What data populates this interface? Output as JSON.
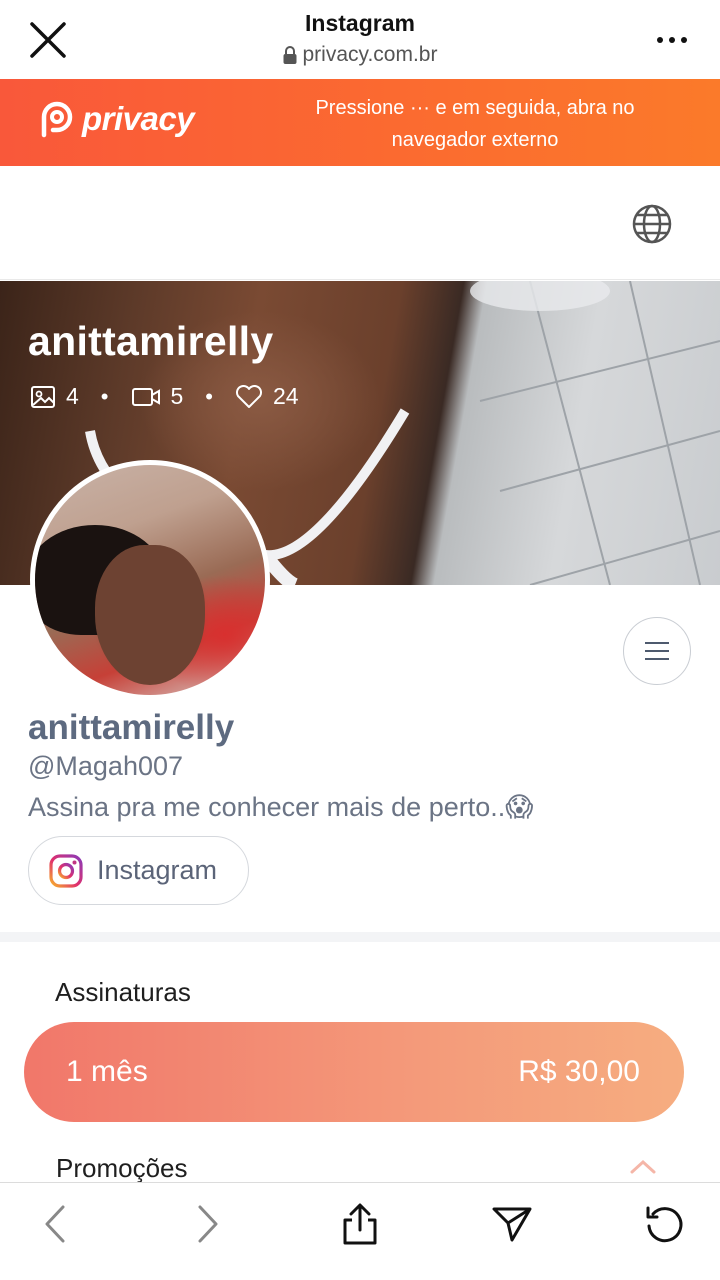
{
  "browser": {
    "title": "Instagram",
    "url": "privacy.com.br"
  },
  "banner": {
    "brand": "privacy",
    "message": "Pressione ··· e em seguida, abra no navegador externo"
  },
  "cover": {
    "name": "anittamirelly",
    "stats": {
      "photos": "4",
      "videos": "5",
      "likes": "24"
    }
  },
  "profile": {
    "name": "anittamirelly",
    "handle": "@Magah007",
    "bio": "Assina pra me conhecer mais de perto..😱",
    "instagram_label": "Instagram"
  },
  "subscriptions": {
    "title": "Assinaturas",
    "plan": {
      "period": "1 mês",
      "price": "R$ 30,00"
    },
    "promotions_title": "Promoções"
  },
  "colors": {
    "banner_start": "#f9583a",
    "banner_end": "#fb7a2a",
    "plan_start": "#f1776a",
    "plan_end": "#f6ad80",
    "profile_text": "#5d6a80"
  }
}
